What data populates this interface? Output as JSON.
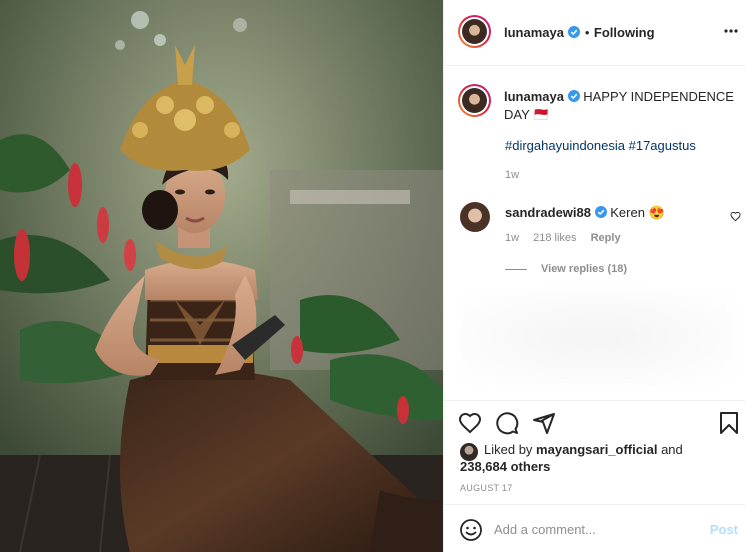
{
  "post": {
    "author": "lunamaya",
    "follow_separator": "•",
    "follow_status": "Following"
  },
  "caption": {
    "author": "lunamaya",
    "text": "HAPPY INDEPENDENCE DAY 🇲🇨",
    "hashtags": [
      "#dirgahayuindonesia",
      "#17agustus"
    ],
    "time": "1w"
  },
  "comments": [
    {
      "author": "sandradewi88",
      "text": "Keren 😍",
      "time": "1w",
      "likes": "218 likes",
      "reply_label": "Reply"
    }
  ],
  "view_replies": "View replies (18)",
  "likes": {
    "prefix": "Liked by",
    "user": "mayangsari_official",
    "middle": "and",
    "count": "238,684 others"
  },
  "date": "AUGUST 17",
  "comment_box": {
    "placeholder": "Add a comment...",
    "post_label": "Post"
  },
  "icons": {
    "verified": "verified-badge-icon",
    "more": "more-options-icon",
    "like": "heart-icon",
    "comment": "comment-icon",
    "share": "send-icon",
    "save": "bookmark-icon",
    "emoji": "emoji-icon"
  },
  "colors": {
    "link": "#00376b",
    "verified": "#3897f0",
    "muted": "#8e8e8e",
    "post_disabled": "#b2dffc"
  }
}
